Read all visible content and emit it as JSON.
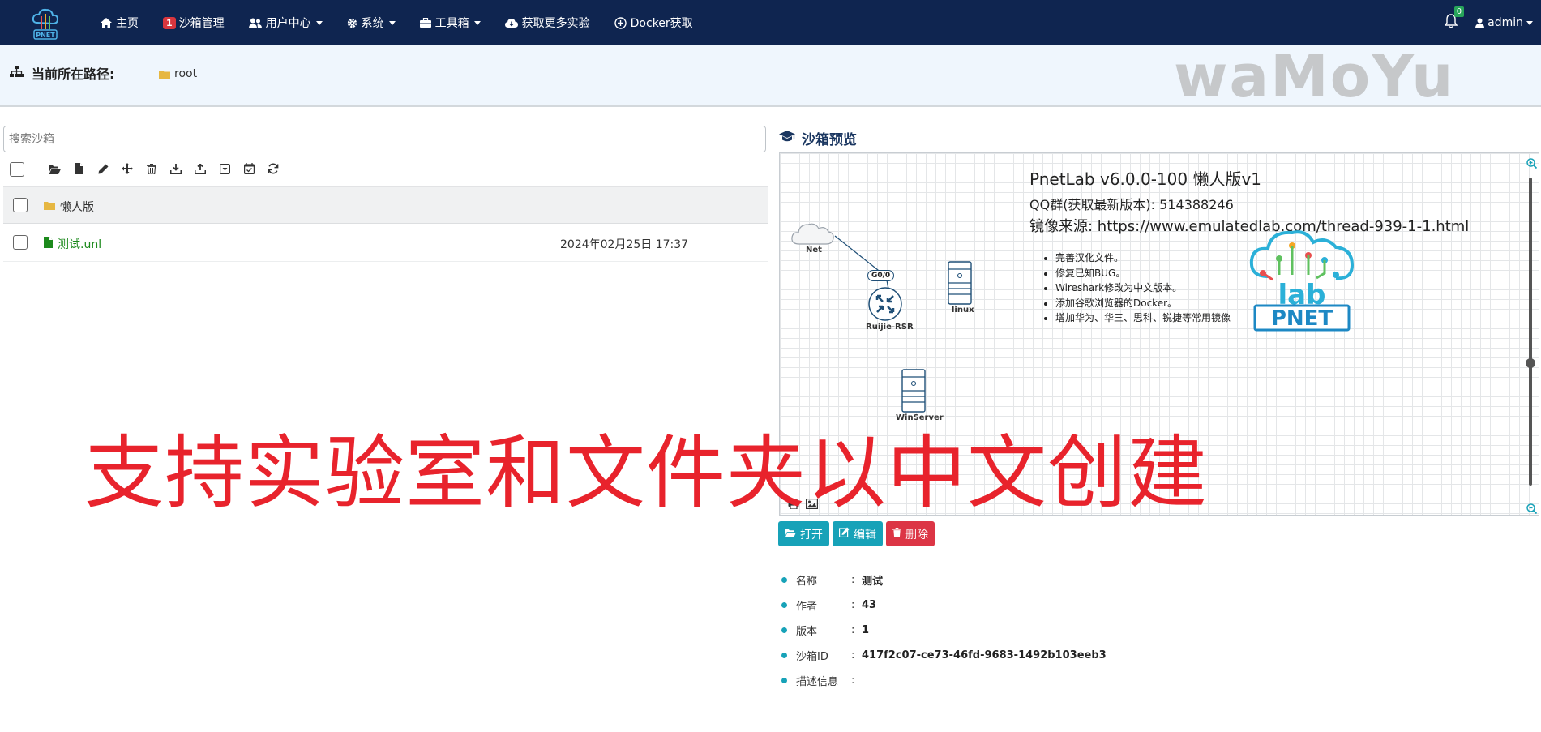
{
  "nav": {
    "items": [
      {
        "label": "主页",
        "icon": "home-icon"
      },
      {
        "label": "沙箱管理",
        "icon": "sandbox-icon",
        "badge": "1"
      },
      {
        "label": "用户中心",
        "icon": "users-icon"
      },
      {
        "label": "系统",
        "icon": "gear-icon"
      },
      {
        "label": "工具箱",
        "icon": "toolbox-icon"
      },
      {
        "label": "获取更多实验",
        "icon": "cloud-download-icon"
      },
      {
        "label": "Docker获取",
        "icon": "plus-circle-icon"
      }
    ],
    "notifications": "0",
    "user": "admin"
  },
  "path": {
    "title": "当前所在路径:",
    "root": "root",
    "watermark": "waMoYu"
  },
  "search": {
    "placeholder": "搜索沙箱"
  },
  "files": {
    "folder": {
      "name": "懒人版"
    },
    "lab": {
      "name": "测试.unl",
      "date": "2024年02月25日 17:37"
    }
  },
  "preview": {
    "title": "沙箱预览",
    "lab_title": "PnetLab v6.0.0-100 懒人版v1",
    "qq": "QQ群(获取最新版本):  514388246",
    "source": "镜像来源:  https://www.emulatedlab.com/thread-939-1-1.html",
    "notes": [
      "完善汉化文件。",
      "修复已知BUG。",
      "Wireshark修改为中文版本。",
      "添加谷歌浏览器的Docker。",
      "增加华为、华三、思科、锐捷等常用镜像"
    ],
    "nodes": {
      "cloud": "Net",
      "router": "Ruijie-RSR",
      "port": "G0/0",
      "linux": "linux",
      "win": "WinServer"
    },
    "logo": {
      "top": "lab",
      "bottom": "PNET"
    }
  },
  "actions": {
    "open": "打开",
    "edit": "编辑",
    "delete": "删除"
  },
  "props": [
    {
      "key": "名称",
      "value": "测试"
    },
    {
      "key": "作者",
      "value": "43"
    },
    {
      "key": "版本",
      "value": "1"
    },
    {
      "key": "沙箱ID",
      "value": "417f2c07-ce73-46fd-9683-1492b103eeb3"
    },
    {
      "key": "描述信息",
      "value": ""
    }
  ],
  "overlay_text": "支持实验室和文件夹以中文创建",
  "colors": {
    "navbar": "#0f2550",
    "accent": "#17a2b8",
    "danger": "#dc3545",
    "overlay": "#e8232c",
    "file_green": "#1c8a1c"
  }
}
